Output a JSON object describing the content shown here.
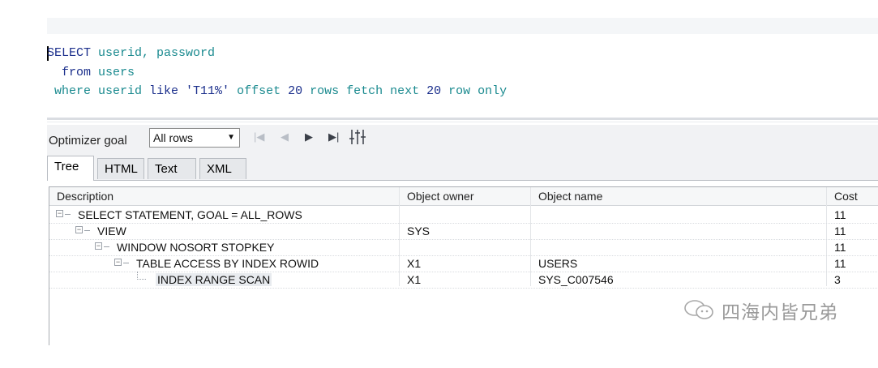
{
  "editor": {
    "sql": [
      [
        {
          "t": "SELECT ",
          "c": "kw"
        },
        {
          "t": "userid, password",
          "c": "id"
        }
      ],
      [
        {
          "t": "  from ",
          "c": "kw"
        },
        {
          "t": "users",
          "c": "id"
        }
      ],
      [
        {
          "t": " where ",
          "c": "id"
        },
        {
          "t": "userid ",
          "c": "id"
        },
        {
          "t": "like ",
          "c": "kw"
        },
        {
          "t": "'T11%' ",
          "c": "str"
        },
        {
          "t": "offset ",
          "c": "id"
        },
        {
          "t": "20 ",
          "c": "num"
        },
        {
          "t": "rows ",
          "c": "id"
        },
        {
          "t": "fetch ",
          "c": "id"
        },
        {
          "t": "next ",
          "c": "id"
        },
        {
          "t": "20 ",
          "c": "num"
        },
        {
          "t": "row ",
          "c": "id"
        },
        {
          "t": "only",
          "c": "id"
        }
      ]
    ]
  },
  "toolbar": {
    "optimizer_label": "Optimizer goal",
    "optimizer_value": "All rows"
  },
  "tabs": [
    "Tree",
    "HTML",
    "Text",
    "XML"
  ],
  "grid": {
    "headers": [
      "Description",
      "Object owner",
      "Object name",
      "Cost"
    ],
    "rows": [
      {
        "desc": "SELECT STATEMENT, GOAL = ALL_ROWS",
        "owner": "",
        "name": "",
        "cost": "11",
        "level": 0,
        "toggle": true
      },
      {
        "desc": "VIEW",
        "owner": "SYS",
        "name": "",
        "cost": "11",
        "level": 1,
        "toggle": true
      },
      {
        "desc": "WINDOW NOSORT STOPKEY",
        "owner": "",
        "name": "",
        "cost": "11",
        "level": 2,
        "toggle": true
      },
      {
        "desc": "TABLE ACCESS BY INDEX ROWID",
        "owner": "X1",
        "name": "USERS",
        "cost": "11",
        "level": 3,
        "toggle": true
      },
      {
        "desc": "INDEX RANGE SCAN",
        "owner": "X1",
        "name": "SYS_C007546",
        "cost": "3",
        "level": 4,
        "toggle": false
      }
    ]
  },
  "watermark": {
    "text": "四海内皆兄弟",
    "icon": "wechat-icon"
  }
}
